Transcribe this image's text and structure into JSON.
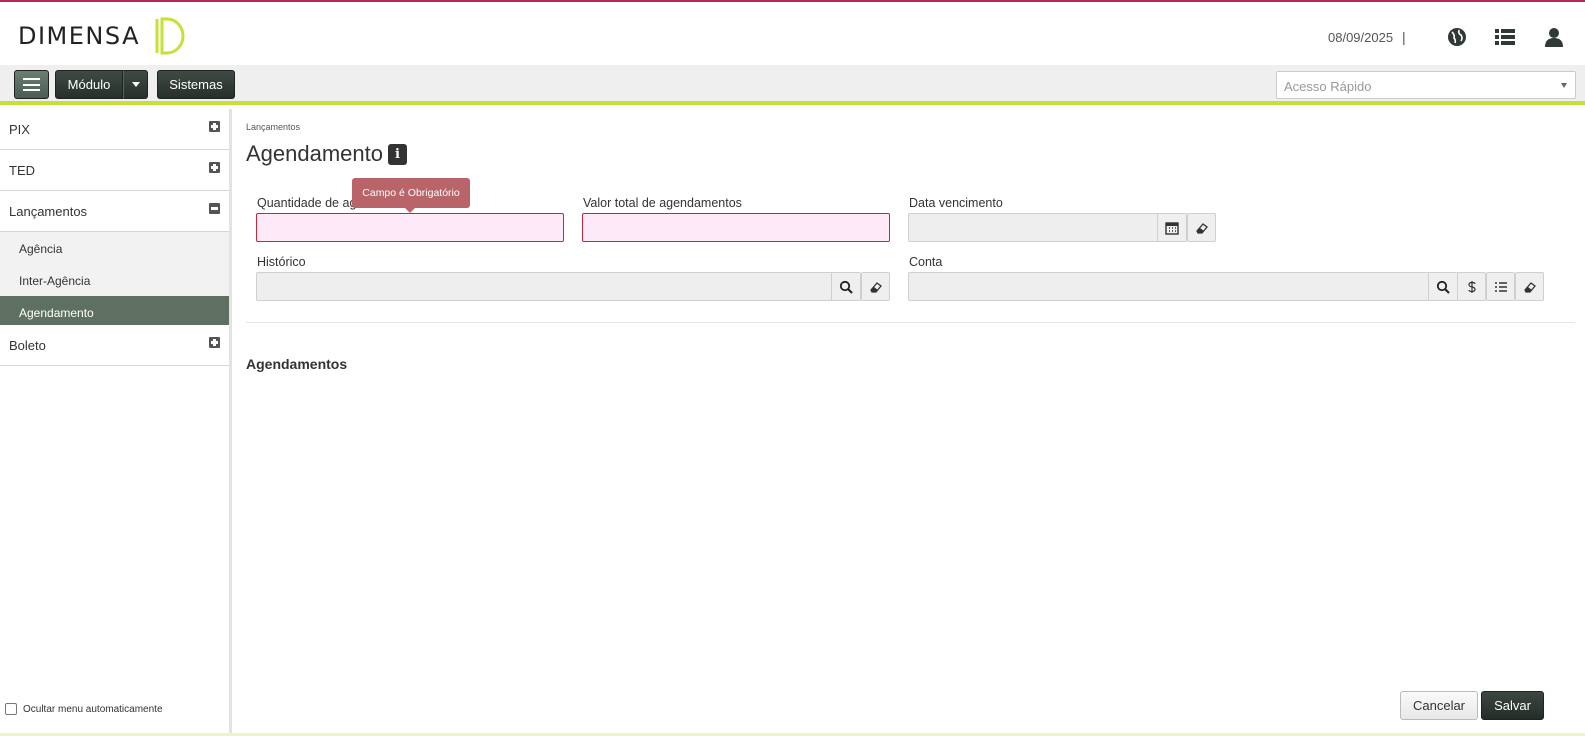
{
  "brand": {
    "name": "DIMENSA"
  },
  "header": {
    "date": "08/09/2025",
    "separator": "|",
    "icons": [
      "globe-icon",
      "list-icon",
      "user-icon"
    ]
  },
  "toolbar": {
    "module_label": "Módulo",
    "systems_label": "Sistemas",
    "quick_access_placeholder": "Acesso Rápido"
  },
  "sidebar": {
    "groups": [
      {
        "label": "PIX",
        "state": "collapsed"
      },
      {
        "label": "TED",
        "state": "collapsed"
      },
      {
        "label": "Lançamentos",
        "state": "expanded"
      },
      {
        "label": "Boleto",
        "state": "collapsed"
      }
    ],
    "sub_items": [
      {
        "label": "Agência",
        "active": false
      },
      {
        "label": "Inter-Agência",
        "active": false
      },
      {
        "label": "Agendamento",
        "active": true
      }
    ],
    "auto_hide_label": "Ocultar menu automaticamente"
  },
  "page": {
    "breadcrumb": "Lançamentos",
    "title": "Agendamento",
    "tooltip": "Campo é Obrigatório",
    "fields": {
      "quantidade": {
        "label": "Quantidade de agendamentos",
        "visible_label": "Quantidade de ag",
        "value": ""
      },
      "valor_total": {
        "label": "Valor total de agendamentos",
        "value": ""
      },
      "data_vencimento": {
        "label": "Data vencimento",
        "value": ""
      },
      "historico": {
        "label": "Histórico",
        "value": ""
      },
      "conta": {
        "label": "Conta",
        "value": ""
      }
    },
    "section_title": "Agendamentos",
    "buttons": {
      "cancel": "Cancelar",
      "save": "Salvar"
    }
  },
  "colors": {
    "accent": "#c6e035",
    "top_border": "#b6285a",
    "active_menu": "#5e7062",
    "error_border": "#c8283c",
    "tooltip_bg": "#b86468"
  }
}
